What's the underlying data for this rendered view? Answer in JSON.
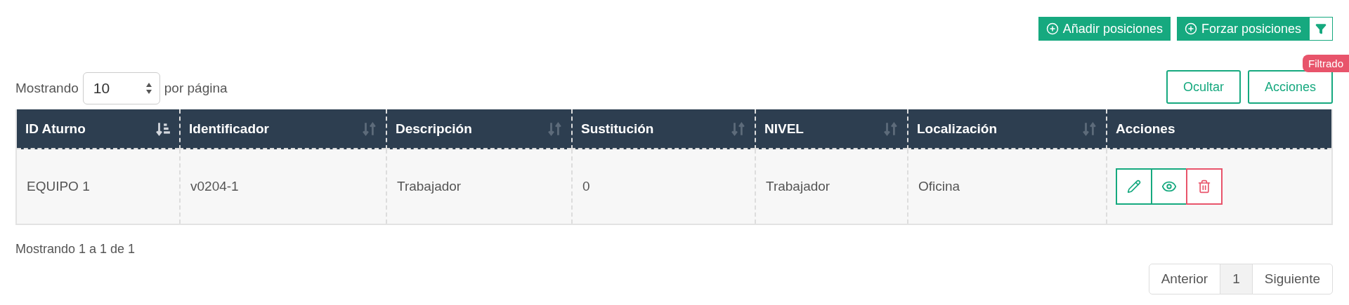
{
  "toolbar": {
    "buttons": [
      {
        "label": "Añadir posiciones"
      },
      {
        "label": "Forzar posiciones"
      }
    ],
    "filter": {
      "active": true,
      "tooltip": "Filtrado"
    }
  },
  "page_size": {
    "prefix": "Mostrando",
    "value": "10",
    "suffix": "por página"
  },
  "column_buttons": [
    "Ocultar",
    "Acciones"
  ],
  "table": {
    "columns": [
      {
        "label": "ID Aturno",
        "sortable": true,
        "sorted": true
      },
      {
        "label": "Identificador",
        "sortable": true,
        "sorted": false
      },
      {
        "label": "Descripción",
        "sortable": true,
        "sorted": false
      },
      {
        "label": "Sustitución",
        "sortable": true,
        "sorted": false
      },
      {
        "label": "NIVEL",
        "sortable": true,
        "sorted": false
      },
      {
        "label": "Localización",
        "sortable": true,
        "sorted": false
      },
      {
        "label": "Acciones",
        "sortable": false
      }
    ],
    "rows": [
      {
        "cells": [
          "EQUIPO 1",
          "v0204-1",
          "Trabajador",
          "0",
          "Trabajador",
          "Oficina"
        ],
        "actions": [
          {
            "kind": "edit"
          },
          {
            "kind": "view"
          },
          {
            "kind": "delete"
          }
        ]
      }
    ]
  },
  "summary": "Mostrando 1 a 1 de 1",
  "pagination": {
    "previous": "Anterior",
    "pages": [
      {
        "label": "1",
        "selected": true
      }
    ],
    "next": "Siguiente"
  }
}
